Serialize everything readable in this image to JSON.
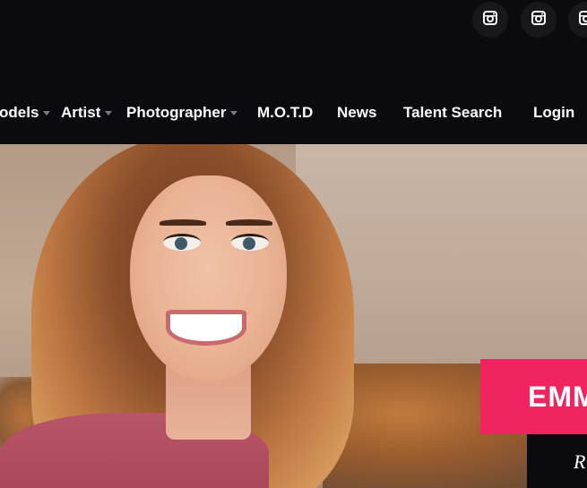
{
  "social": {
    "icons": [
      "instagram-icon",
      "instagram-icon",
      "instagram-icon"
    ]
  },
  "nav": {
    "items": [
      {
        "label": "odels",
        "has_dropdown": true
      },
      {
        "label": "Artist",
        "has_dropdown": true
      },
      {
        "label": "Photographer",
        "has_dropdown": true
      },
      {
        "label": "M.O.T.D",
        "has_dropdown": false
      },
      {
        "label": "News",
        "has_dropdown": false
      },
      {
        "label": "Talent Search",
        "has_dropdown": false
      },
      {
        "label": "Login",
        "has_dropdown": false
      }
    ]
  },
  "hero": {
    "name_banner": "EMM",
    "sub_banner": "R"
  },
  "colors": {
    "background": "#0b0b0f",
    "accent": "#f0245f",
    "nav_text": "#ffffff"
  }
}
